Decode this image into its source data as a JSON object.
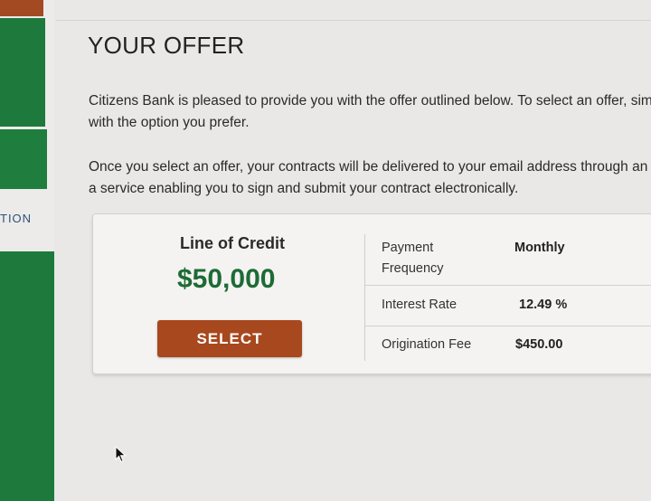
{
  "sidebar": {
    "nav_label": "TION"
  },
  "page": {
    "title": "YOUR OFFER",
    "paragraph_1_line_1": "Citizens Bank is pleased to provide you with the offer outlined below. To select an offer, simp",
    "paragraph_1_line_2": "with the option you prefer.",
    "paragraph_2_line_1": "Once you select an offer, your contracts will be delivered to your email address through an el",
    "paragraph_2_line_2": "a service enabling you to sign and submit your contract electronically."
  },
  "offer": {
    "product": "Line of Credit",
    "amount": "$50,000",
    "select_label": "SELECT",
    "details": [
      {
        "label": "Payment Frequency",
        "value": "Monthly"
      },
      {
        "label": "Interest Rate",
        "value": "12.49 %"
      },
      {
        "label": "Origination Fee",
        "value": "$450.00"
      }
    ]
  },
  "colors": {
    "brand_green": "#1d7a3c",
    "amount_green": "#1d6b35",
    "select_button": "#a8481e"
  }
}
